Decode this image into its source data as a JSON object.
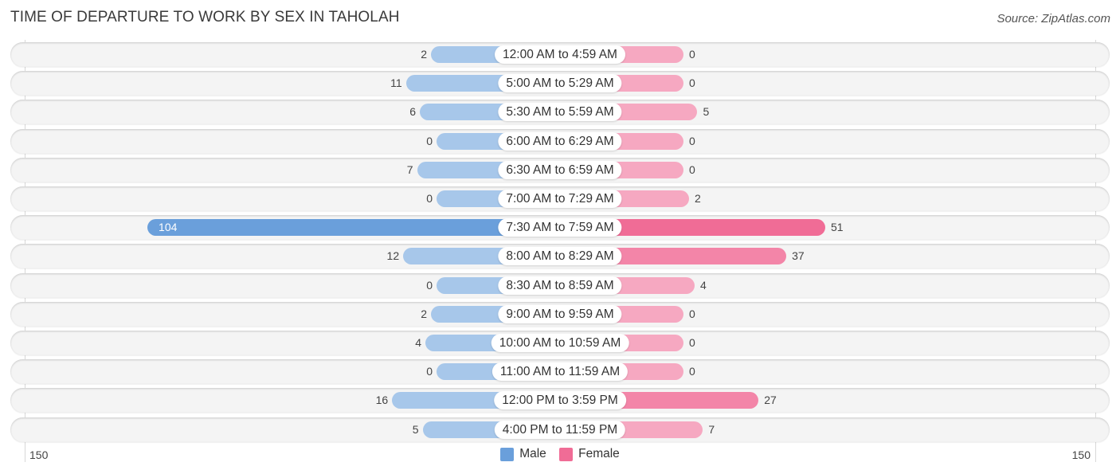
{
  "header": {
    "title": "TIME OF DEPARTURE TO WORK BY SEX IN TAHOLAH",
    "source": "Source: ZipAtlas.com"
  },
  "colors": {
    "male": "#6a9fdb",
    "male_light": "#a7c7ea",
    "female": "#f06c96",
    "female_light": "#f6a8c1"
  },
  "chart_data": {
    "type": "bar",
    "orientation": "horizontal-diverging",
    "title": "TIME OF DEPARTURE TO WORK BY SEX IN TAHOLAH",
    "categories": [
      "12:00 AM to 4:59 AM",
      "5:00 AM to 5:29 AM",
      "5:30 AM to 5:59 AM",
      "6:00 AM to 6:29 AM",
      "6:30 AM to 6:59 AM",
      "7:00 AM to 7:29 AM",
      "7:30 AM to 7:59 AM",
      "8:00 AM to 8:29 AM",
      "8:30 AM to 8:59 AM",
      "9:00 AM to 9:59 AM",
      "10:00 AM to 10:59 AM",
      "11:00 AM to 11:59 AM",
      "12:00 PM to 3:59 PM",
      "4:00 PM to 11:59 PM"
    ],
    "series": [
      {
        "name": "Male",
        "values": [
          2,
          11,
          6,
          0,
          7,
          0,
          104,
          12,
          0,
          2,
          4,
          0,
          16,
          5
        ]
      },
      {
        "name": "Female",
        "values": [
          0,
          0,
          5,
          0,
          0,
          2,
          51,
          37,
          4,
          0,
          0,
          0,
          27,
          7
        ]
      }
    ],
    "axis": {
      "left_tick": "150",
      "right_tick": "150",
      "range": [
        0,
        150
      ]
    },
    "legend": {
      "position": "bottom-center",
      "entries": [
        "Male",
        "Female"
      ]
    },
    "grid": false
  }
}
